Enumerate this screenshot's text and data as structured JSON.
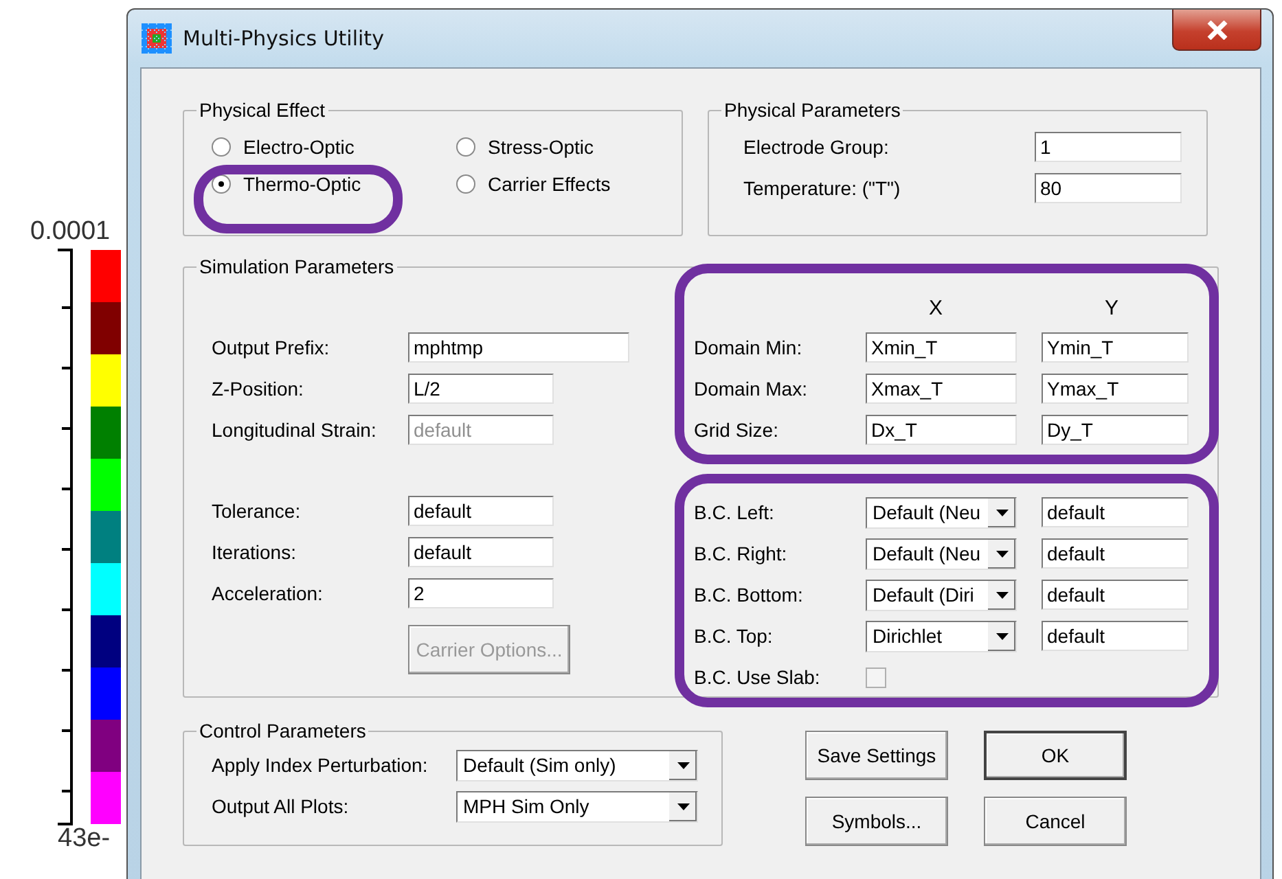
{
  "colorbar": {
    "top_label": "0.0001",
    "bottom_label": "43e-",
    "segments": [
      {
        "color": "#ff0000"
      },
      {
        "color": "#800000"
      },
      {
        "color": "#ffff00"
      },
      {
        "color": "#008000"
      },
      {
        "color": "#00ff00"
      },
      {
        "color": "#008080"
      },
      {
        "color": "#00ffff"
      },
      {
        "color": "#000080"
      },
      {
        "color": "#0000ff"
      },
      {
        "color": "#800080"
      },
      {
        "color": "#ff00ff"
      }
    ]
  },
  "window": {
    "title": "Multi-Physics Utility"
  },
  "physical_effect": {
    "title": "Physical Effect",
    "options": [
      {
        "label": "Electro-Optic",
        "selected": false
      },
      {
        "label": "Thermo-Optic",
        "selected": true
      },
      {
        "label": "Stress-Optic",
        "selected": false
      },
      {
        "label": "Carrier Effects",
        "selected": false
      }
    ]
  },
  "physical_parameters": {
    "title": "Physical Parameters",
    "fields": [
      {
        "label": "Electrode Group:",
        "value": "1"
      },
      {
        "label": "Temperature: (\"T\")",
        "value": "80"
      }
    ]
  },
  "simulation_parameters": {
    "title": "Simulation Parameters",
    "fields": [
      {
        "label": "Output Prefix:",
        "value": "mphtmp",
        "disabled": false,
        "wide": true
      },
      {
        "label": "Z-Position:",
        "value": "L/2",
        "disabled": false,
        "wide": false
      },
      {
        "label": "Longitudinal Strain:",
        "value": "default",
        "disabled": true,
        "wide": false
      }
    ],
    "solver_fields": [
      {
        "label": "Tolerance:",
        "value": "default"
      },
      {
        "label": "Iterations:",
        "value": "default"
      },
      {
        "label": "Acceleration:",
        "value": "2"
      }
    ],
    "carrier_button": {
      "label": "Carrier Options...",
      "disabled": true
    },
    "grid_columns": [
      "X",
      "Y"
    ],
    "grid_rows": [
      {
        "label": "Domain Min:",
        "x": "Xmin_T",
        "y": "Ymin_T"
      },
      {
        "label": "Domain Max:",
        "x": "Xmax_T",
        "y": "Ymax_T"
      },
      {
        "label": "Grid Size:",
        "x": "Dx_T",
        "y": "Dy_T"
      }
    ],
    "boundary_rows": [
      {
        "label": "B.C. Left:",
        "type": "Default (Neu",
        "value": "default"
      },
      {
        "label": "B.C. Right:",
        "type": "Default (Neu",
        "value": "default"
      },
      {
        "label": "B.C. Bottom:",
        "type": "Default (Diri",
        "value": "default"
      },
      {
        "label": "B.C. Top:",
        "type": "Dirichlet",
        "value": "default"
      }
    ],
    "use_slab": {
      "label": "B.C. Use Slab:",
      "checked": false
    }
  },
  "control_parameters": {
    "title": "Control Parameters",
    "selects": [
      {
        "label": "Apply Index Perturbation:",
        "value": "Default (Sim only)"
      },
      {
        "label": "Output All Plots:",
        "value": "MPH Sim Only"
      }
    ]
  },
  "buttons": [
    {
      "label": "Save Settings",
      "default": false
    },
    {
      "label": "OK",
      "default": true
    },
    {
      "label": "Symbols...",
      "default": false
    },
    {
      "label": "Cancel",
      "default": false
    }
  ]
}
